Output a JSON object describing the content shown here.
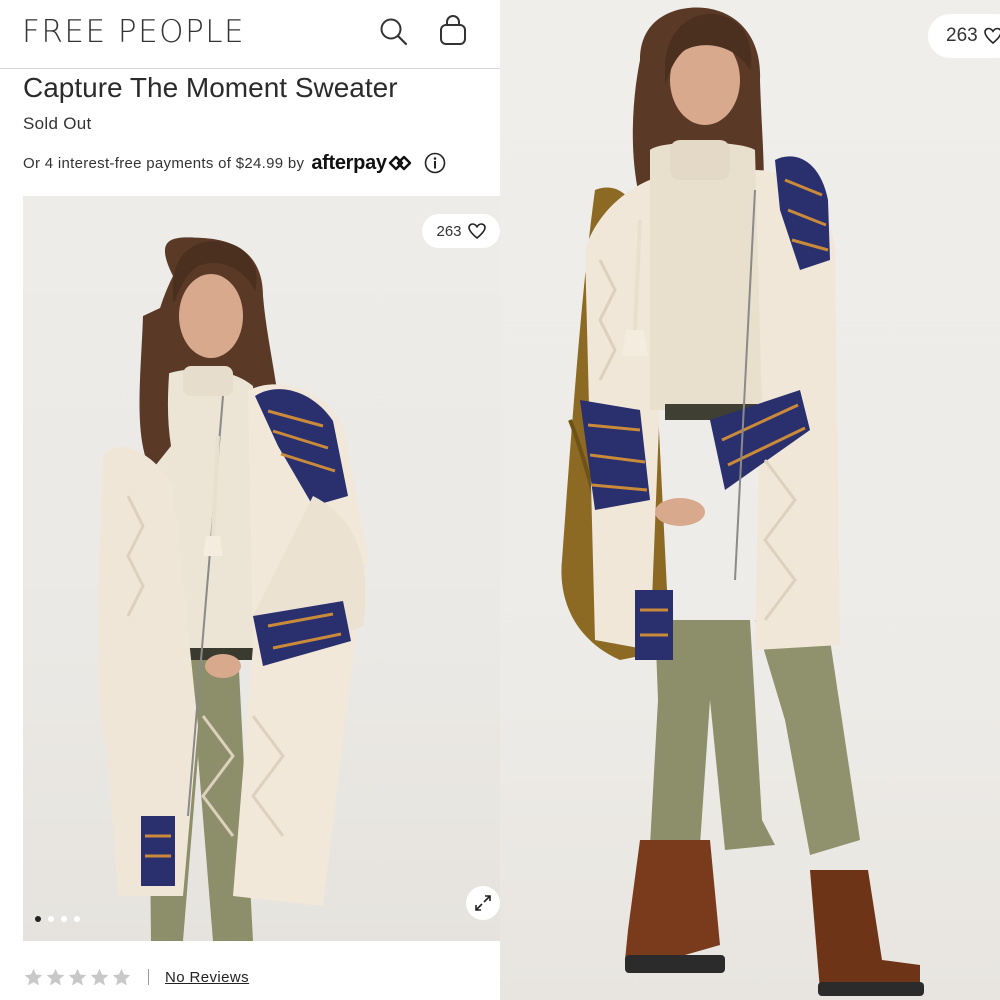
{
  "header": {
    "brand": "FREE PEOPLE",
    "icons": [
      "search-icon",
      "shopping-bag-icon"
    ]
  },
  "product": {
    "title": "Capture The Moment Sweater",
    "status": "Sold Out",
    "payment_text": "Or 4 interest-free payments of $24.99 by",
    "payment_provider": "afterpay"
  },
  "gallery": {
    "likes": "263",
    "like_icon": "heart-icon",
    "expand_icon": "expand-icon",
    "dots_total": 4,
    "active_dot": 1
  },
  "zoomed_image": {
    "likes": "263"
  },
  "reviews": {
    "rating": 0,
    "max_rating": 5,
    "label": "No Reviews"
  },
  "colors": {
    "background": "#efede9",
    "text": "#222222",
    "sweater_cream": "#efe6d8",
    "fair_isle_navy": "#2a2f6e",
    "pants_olive": "#8c8f6a",
    "boots_brown": "#7a3b1c"
  }
}
